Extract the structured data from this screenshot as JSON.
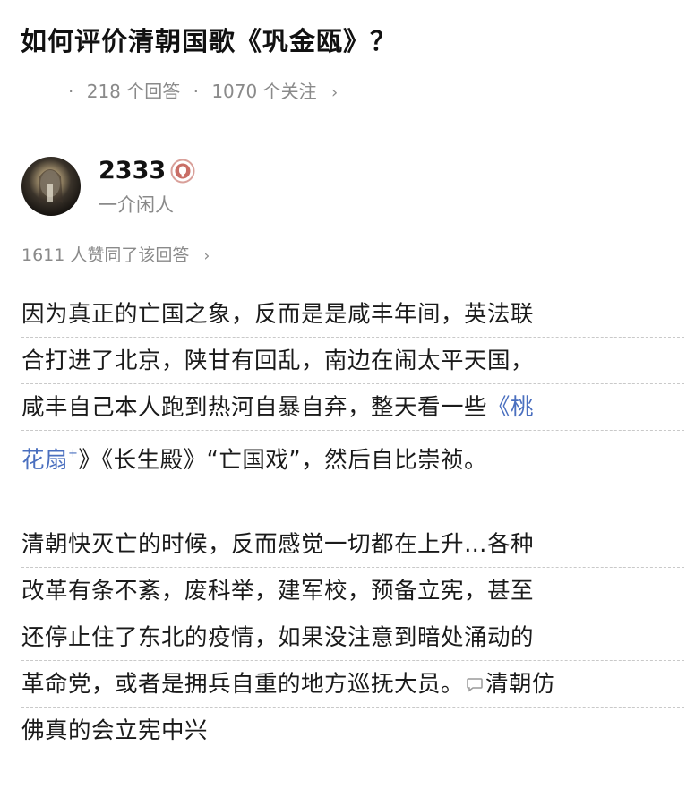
{
  "question": {
    "title": "如何评价清朝国歌《巩金瓯》？",
    "answers": "218 个回答",
    "followers": "1070 个关注",
    "separator": "·",
    "chevron": "›"
  },
  "author": {
    "name": "2333",
    "bio": "一介闲人",
    "badge_icon": "badge-icon",
    "avatar_icon": "avatar"
  },
  "answer": {
    "upvotes": "1611 人赞同了该回答",
    "chevron": "›",
    "paragraph1": {
      "line1": "因为真正的亡国之象，反而是是咸丰年间，英法联",
      "line2": "合打进了北京，陕甘有回乱，南边在闹太平天国，",
      "line3_text": "咸丰自己本人跑到热河自暴自弃，整天看一些",
      "line3_link": "《桃",
      "line4_link": "花扇",
      "line4_link_mark": "+",
      "line4_text": "》《长生殿》“亡国戏”，然后自比崇祯。"
    },
    "paragraph2": {
      "line1": "清朝快灭亡的时候，反而感觉一切都在上升…各种",
      "line2": "改革有条不紊，废科举，建军校，预备立宪，甚至",
      "line3": "还停止住了东北的疫情，如果没注意到暗处涌动的",
      "line4_a": "革命党，或者是拥兵自重的地方巡抚大员。",
      "line4_b": "清朝仿",
      "line5": "佛真的会立宪中兴"
    },
    "comment_icon": "comment-icon",
    "colors": {
      "link": "#4a6fbf",
      "meta": "#8a8a8a",
      "text": "#1a1a1a"
    }
  }
}
